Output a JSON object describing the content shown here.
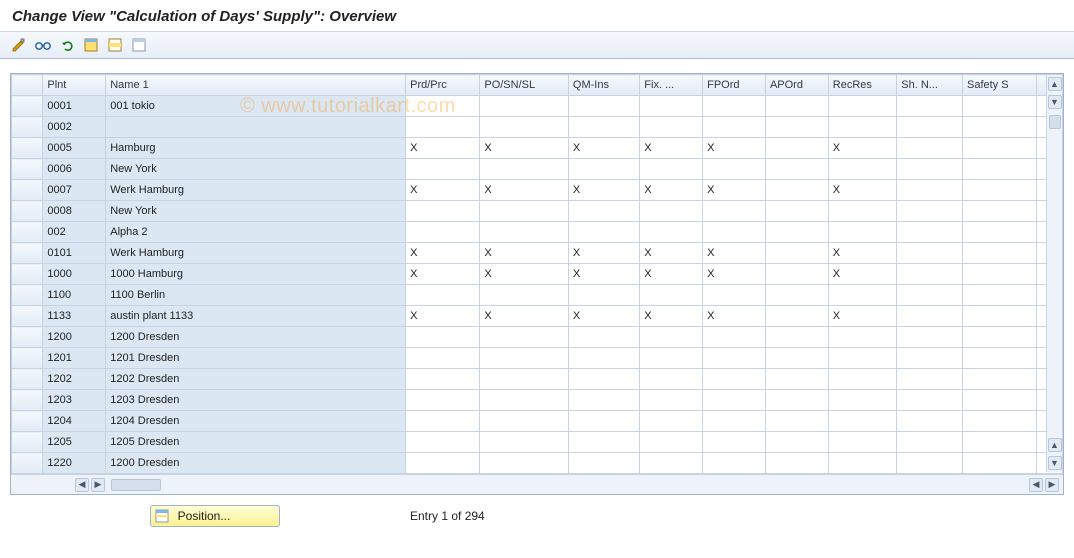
{
  "header": {
    "title": "Change View \"Calculation of Days' Supply\": Overview"
  },
  "watermark": "© www.tutorialkart.com",
  "toolbar": {
    "icons": [
      "toggle-display-change-icon",
      "glasses-icon",
      "undo-icon",
      "select-all-icon",
      "select-block-icon",
      "deselect-all-icon"
    ]
  },
  "table": {
    "columns": [
      "Plnt",
      "Name 1",
      "Prd/Prc",
      "PO/SN/SL",
      "QM-Ins",
      "Fix. ...",
      "FPOrd",
      "APOrd",
      "RecRes",
      "Sh. N...",
      "Safety S"
    ],
    "rows": [
      {
        "plnt": "0001",
        "name": "001 tokio",
        "marks": [
          "",
          "",
          "",
          "",
          "",
          "",
          "",
          "",
          ""
        ]
      },
      {
        "plnt": "0002",
        "name": "",
        "marks": [
          "",
          "",
          "",
          "",
          "",
          "",
          "",
          "",
          ""
        ]
      },
      {
        "plnt": "0005",
        "name": "Hamburg",
        "marks": [
          "X",
          "X",
          "X",
          "X",
          "X",
          "",
          "X",
          "",
          ""
        ]
      },
      {
        "plnt": "0006",
        "name": "New York",
        "marks": [
          "",
          "",
          "",
          "",
          "",
          "",
          "",
          "",
          ""
        ]
      },
      {
        "plnt": "0007",
        "name": "Werk Hamburg",
        "marks": [
          "X",
          "X",
          "X",
          "X",
          "X",
          "",
          "X",
          "",
          ""
        ]
      },
      {
        "plnt": "0008",
        "name": "New York",
        "marks": [
          "",
          "",
          "",
          "",
          "",
          "",
          "",
          "",
          ""
        ]
      },
      {
        "plnt": "002",
        "name": "Alpha 2",
        "marks": [
          "",
          "",
          "",
          "",
          "",
          "",
          "",
          "",
          ""
        ]
      },
      {
        "plnt": "0101",
        "name": "Werk Hamburg",
        "marks": [
          "X",
          "X",
          "X",
          "X",
          "X",
          "",
          "X",
          "",
          ""
        ]
      },
      {
        "plnt": "1000",
        "name": "1000 Hamburg",
        "marks": [
          "X",
          "X",
          "X",
          "X",
          "X",
          "",
          "X",
          "",
          ""
        ]
      },
      {
        "plnt": "1100",
        "name": "1100 Berlin",
        "marks": [
          "",
          "",
          "",
          "",
          "",
          "",
          "",
          "",
          ""
        ]
      },
      {
        "plnt": "1133",
        "name": "austin plant 1133",
        "marks": [
          "X",
          "X",
          "X",
          "X",
          "X",
          "",
          "X",
          "",
          ""
        ]
      },
      {
        "plnt": "1200",
        "name": "1200 Dresden",
        "marks": [
          "",
          "",
          "",
          "",
          "",
          "",
          "",
          "",
          ""
        ]
      },
      {
        "plnt": "1201",
        "name": "1201 Dresden",
        "marks": [
          "",
          "",
          "",
          "",
          "",
          "",
          "",
          "",
          ""
        ]
      },
      {
        "plnt": "1202",
        "name": "1202 Dresden",
        "marks": [
          "",
          "",
          "",
          "",
          "",
          "",
          "",
          "",
          ""
        ]
      },
      {
        "plnt": "1203",
        "name": "1203 Dresden",
        "marks": [
          "",
          "",
          "",
          "",
          "",
          "",
          "",
          "",
          ""
        ]
      },
      {
        "plnt": "1204",
        "name": "1204 Dresden",
        "marks": [
          "",
          "",
          "",
          "",
          "",
          "",
          "",
          "",
          ""
        ]
      },
      {
        "plnt": "1205",
        "name": "1205 Dresden",
        "marks": [
          "",
          "",
          "",
          "",
          "",
          "",
          "",
          "",
          ""
        ]
      },
      {
        "plnt": "1220",
        "name": "1200 Dresden",
        "marks": [
          "",
          "",
          "",
          "",
          "",
          "",
          "",
          "",
          ""
        ]
      }
    ]
  },
  "footer": {
    "position_label": "Position...",
    "entry_info": "Entry 1 of 294"
  }
}
